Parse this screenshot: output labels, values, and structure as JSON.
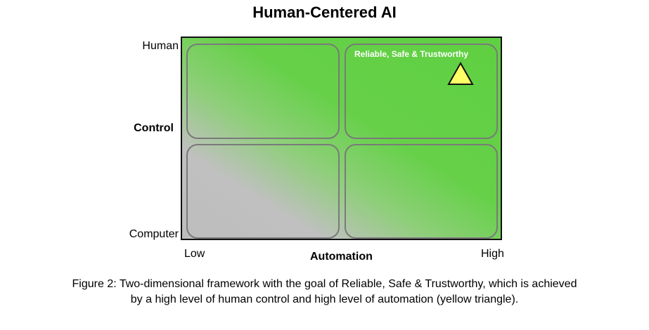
{
  "diagram": {
    "title": "Human-Centered AI",
    "y_axis": {
      "label": "Control",
      "top": "Human",
      "bottom": "Computer"
    },
    "x_axis": {
      "label": "Automation",
      "left": "Low",
      "right": "High"
    },
    "goal": {
      "label": "Reliable, Safe & Trustworthy",
      "marker": "yellow-triangle",
      "marker_color": "#ffff66"
    },
    "colors": {
      "green": "#5fd041",
      "gray": "#bdbdbd",
      "quadrant_border": "#7a7a7a"
    }
  },
  "caption": {
    "line1": "Figure 2: Two-dimensional framework with the goal of Reliable, Safe & Trustworthy, which is achieved",
    "line2": "by a high level of human control and high level of automation (yellow triangle)."
  }
}
